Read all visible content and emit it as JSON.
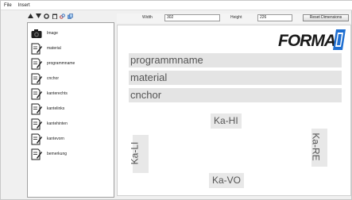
{
  "menu": {
    "items": [
      {
        "label": "File"
      },
      {
        "label": "Insert"
      }
    ]
  },
  "toolbar": {
    "icons": [
      "arrow-up-icon",
      "arrow-down-icon",
      "gear-icon",
      "trash-icon",
      "link-icon",
      "copy-icon"
    ]
  },
  "tree": {
    "items": [
      {
        "label": "Image",
        "icon": "camera-icon"
      },
      {
        "label": "material",
        "icon": "edit-document-icon"
      },
      {
        "label": "programmname",
        "icon": "edit-document-icon"
      },
      {
        "label": "cnchor",
        "icon": "edit-document-icon"
      },
      {
        "label": "kanterechts",
        "icon": "edit-document-icon"
      },
      {
        "label": "kantelinks",
        "icon": "edit-document-icon"
      },
      {
        "label": "kantehinten",
        "icon": "edit-document-icon"
      },
      {
        "label": "kantevorn",
        "icon": "edit-document-icon"
      },
      {
        "label": "bemerkung",
        "icon": "edit-document-icon"
      }
    ]
  },
  "dimensions": {
    "width_label": "Width",
    "width_value": "302",
    "height_label": "Height",
    "height_value": "226",
    "reset_label": "Reset Dimensions"
  },
  "canvas": {
    "logo_text": "FORMA",
    "logo_mark_color": "#1f6fd1",
    "fields": {
      "programmname": "programmname",
      "material": "material",
      "cnchor": "cnchor"
    },
    "edges": {
      "hi": "Ka-HI",
      "vo": "Ka-VO",
      "li": "Ka-LI",
      "re": "Ka-RE"
    }
  }
}
